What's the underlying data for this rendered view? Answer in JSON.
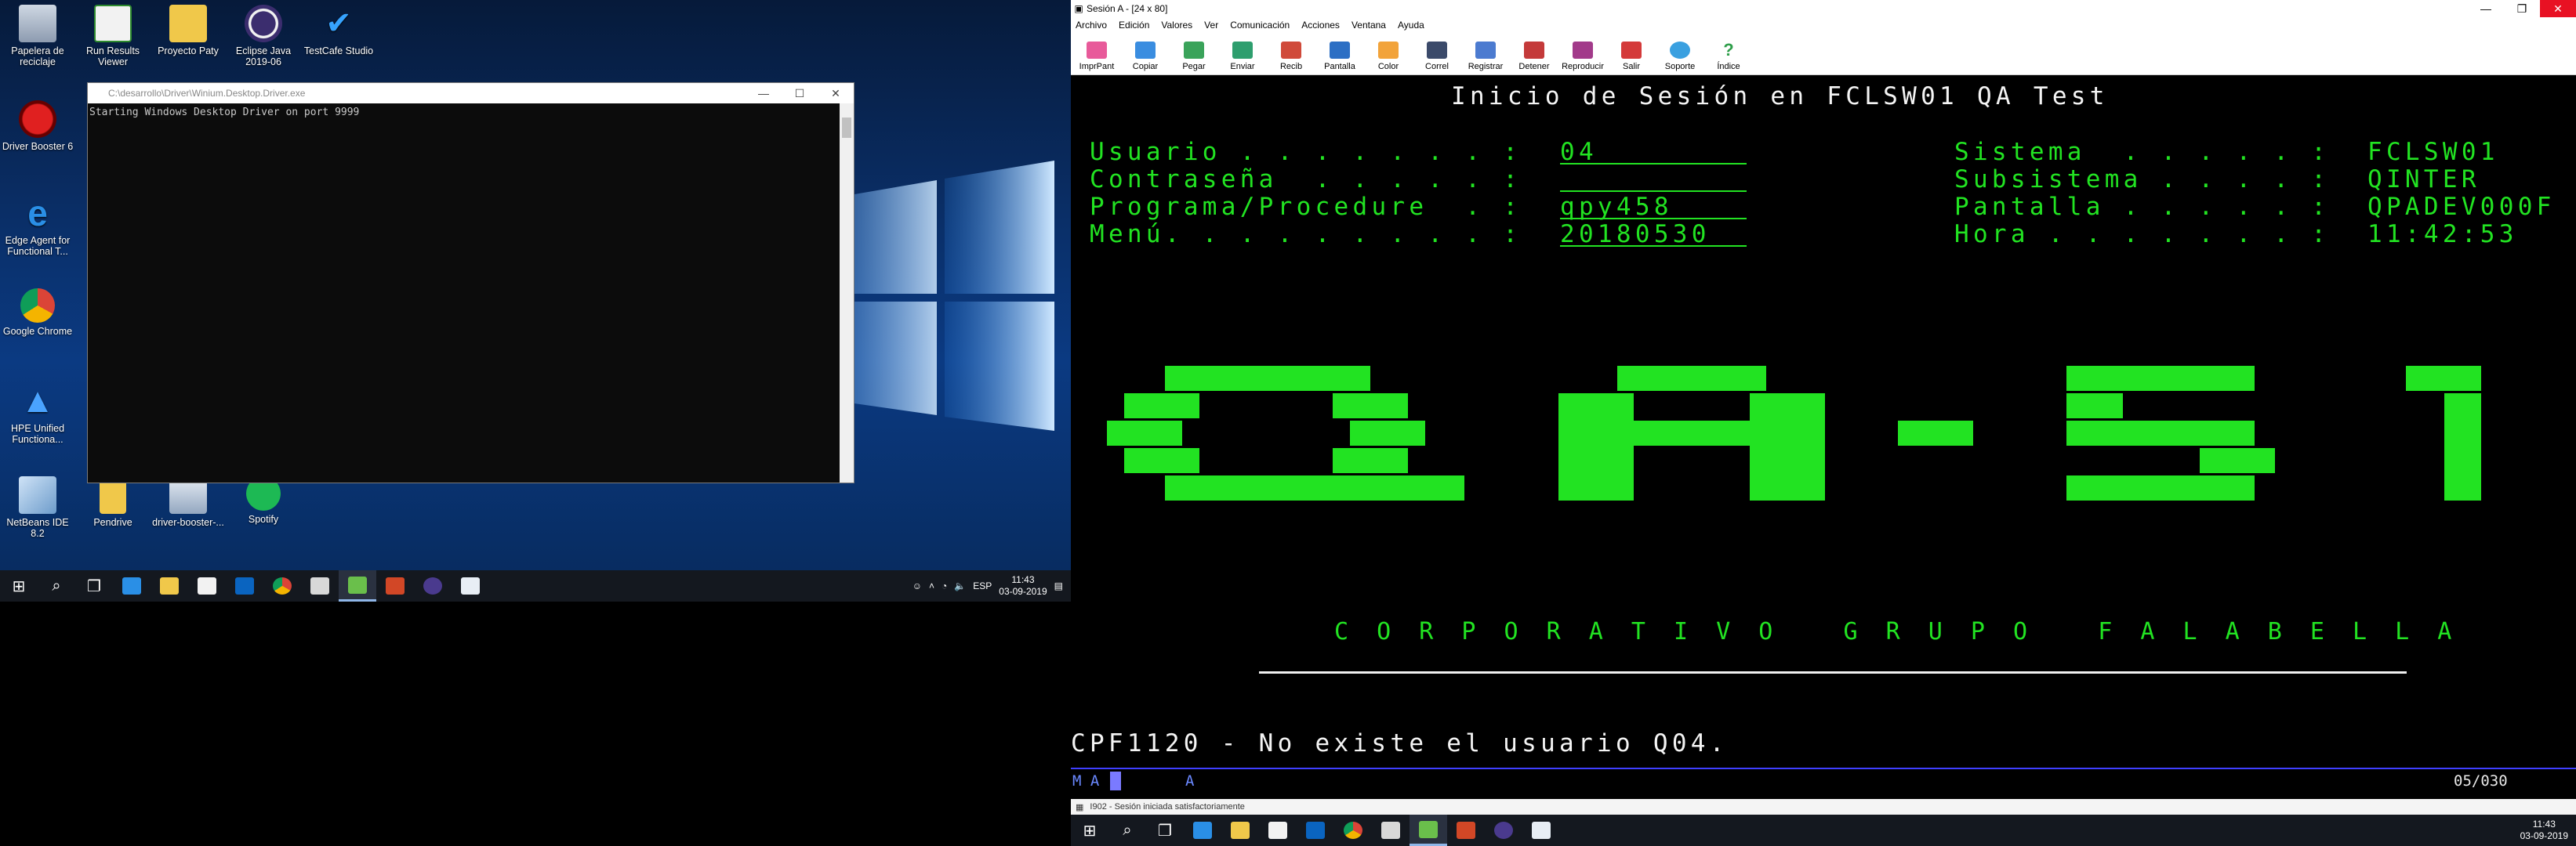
{
  "desktop_icons": [
    {
      "label": "Papelera de reciclaje",
      "icon": "recycle-bin-icon"
    },
    {
      "label": "Run Results Viewer",
      "icon": "results-viewer-icon"
    },
    {
      "label": "Proyecto Paty",
      "icon": "folder-icon"
    },
    {
      "label": "Eclipse Java 2019-06",
      "icon": "eclipse-icon"
    },
    {
      "label": "TestCafe Studio",
      "icon": "testcafe-icon"
    },
    {
      "label": "Driver Booster 6",
      "icon": "driver-booster-icon"
    },
    {
      "label": "Edge Agent for Functional T...",
      "icon": "edge-agent-icon"
    },
    {
      "label": "Google Chrome",
      "icon": "chrome-icon"
    },
    {
      "label": "HPE Unified Functiona...",
      "icon": "hpe-uft-icon"
    },
    {
      "label": "NetBeans IDE 8.2",
      "icon": "netbeans-icon"
    },
    {
      "label": "Pendrive",
      "icon": "usb-drive-icon"
    },
    {
      "label": "driver-booster-...",
      "icon": "installer-icon"
    },
    {
      "label": "Spotify",
      "icon": "spotify-icon"
    }
  ],
  "console": {
    "title": "C:\\desarrollo\\Driver\\Winium.Desktop.Driver.exe",
    "output": "Starting Windows Desktop Driver on port 9999"
  },
  "taskbar_left": {
    "lang": "ESP",
    "time": "11:43",
    "date": "03-09-2019"
  },
  "emulator": {
    "title": "Sesión A - [24 x 80]",
    "menu": [
      "Archivo",
      "Edición",
      "Valores",
      "Ver",
      "Comunicación",
      "Acciones",
      "Ventana",
      "Ayuda"
    ],
    "tools": [
      "ImprPant",
      "Copiar",
      "Pegar",
      "Enviar",
      "Recib",
      "Pantalla",
      "Color",
      "Correl",
      "Registrar",
      "Detener",
      "Reproducir",
      "Salir",
      "Soporte",
      "Índice"
    ],
    "screen": {
      "heading": "Inicio de Sesión en FCLSW01 QA Test",
      "labels": {
        "usuario": "Usuario . . . . . . . :",
        "contrasena": "Contraseña  . . . . . :",
        "programa": "Programa/Procedure  . :",
        "menu": "Menú. . . . . . . . . :"
      },
      "values": {
        "usuario": "04",
        "contrasena": "",
        "programa": "qpy458",
        "menu": "20180530"
      },
      "sys_labels": {
        "sistema": "Sistema  . . . . . :",
        "subsistema": "Subsistema . . . . :",
        "pantalla": "Pantalla . . . . . :",
        "hora": "Hora . . . . . . . :"
      },
      "sys_values": {
        "sistema": "FCLSW01",
        "subsistema": "QINTER",
        "pantalla": "QPADEV000F",
        "hora": "11:42:53"
      },
      "logo_text": "QA-S1",
      "corporate": "C O R P O R A T I V O   G R U P O   F A L A B E L L A",
      "message": "CPF1120 - No existe el usuario Q04."
    },
    "oia": {
      "left": "M A",
      "mid": "A",
      "cursor": "05/030"
    },
    "status_bar": "I902 - Sesión iniciada satisfactoriamente"
  },
  "taskbar_right": {
    "time": "11:43",
    "date": "03-09-2019"
  }
}
